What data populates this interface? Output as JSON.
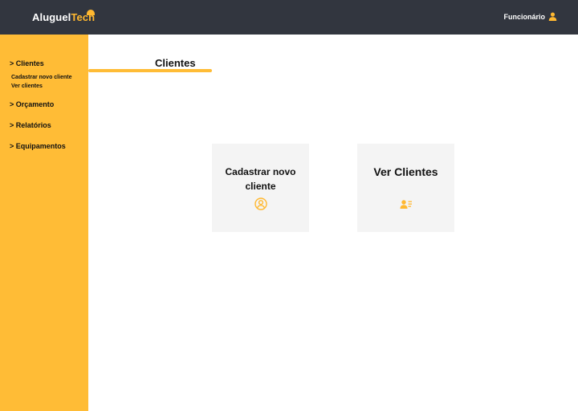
{
  "app": {
    "logo_part1": "Aluguel",
    "logo_part2": "Tech",
    "brand_color": "#ffb830",
    "header_color": "#32363f"
  },
  "header": {
    "user_label": "Funcionário",
    "user_icon": "user-icon"
  },
  "sidebar": {
    "items": [
      {
        "label": "> Clientes",
        "subitems": [
          "Cadastrar novo cliente",
          "Ver clientes"
        ]
      },
      {
        "label": "> Orçamento"
      },
      {
        "label": "> Relatórios"
      },
      {
        "label": "> Equipamentos"
      }
    ]
  },
  "main": {
    "title": "Clientes",
    "cards": [
      {
        "label": "Cadastrar novo cliente",
        "icon": "user-circle-icon"
      },
      {
        "label": "Ver Clientes",
        "icon": "user-list-icon"
      }
    ]
  }
}
